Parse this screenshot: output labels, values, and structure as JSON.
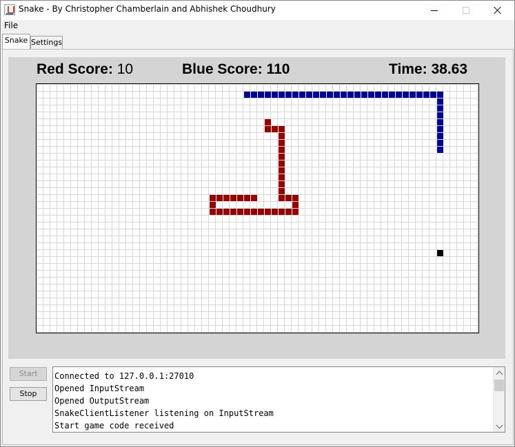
{
  "window": {
    "title": "Snake - By Christopher Chamberlain and Abhishek Choudhury",
    "icon": "java-cup-icon",
    "controls": [
      "minimize-icon",
      "maximize-icon",
      "close-icon"
    ]
  },
  "menubar": {
    "file_label": "File"
  },
  "tabs": [
    {
      "label": "Snake",
      "active": true
    },
    {
      "label": "Settings",
      "active": false
    }
  ],
  "hud": {
    "red_label": "Red Score:",
    "red_value": "10",
    "blue_label": "Blue Score:",
    "blue_value": "110",
    "time_label": "Time:",
    "time_value": "38.63"
  },
  "board": {
    "columns": 64,
    "rows": 36,
    "colors": {
      "red": "#990000",
      "blue": "#000099",
      "food": "#000000",
      "grid": "#d6d6d6"
    },
    "blue_snake": [
      [
        30,
        1
      ],
      [
        31,
        1
      ],
      [
        32,
        1
      ],
      [
        33,
        1
      ],
      [
        34,
        1
      ],
      [
        35,
        1
      ],
      [
        36,
        1
      ],
      [
        37,
        1
      ],
      [
        38,
        1
      ],
      [
        39,
        1
      ],
      [
        40,
        1
      ],
      [
        41,
        1
      ],
      [
        42,
        1
      ],
      [
        43,
        1
      ],
      [
        44,
        1
      ],
      [
        45,
        1
      ],
      [
        46,
        1
      ],
      [
        47,
        1
      ],
      [
        48,
        1
      ],
      [
        49,
        1
      ],
      [
        50,
        1
      ],
      [
        51,
        1
      ],
      [
        52,
        1
      ],
      [
        53,
        1
      ],
      [
        54,
        1
      ],
      [
        55,
        1
      ],
      [
        56,
        1
      ],
      [
        57,
        1
      ],
      [
        58,
        1
      ],
      [
        58,
        2
      ],
      [
        58,
        3
      ],
      [
        58,
        4
      ],
      [
        58,
        5
      ],
      [
        58,
        6
      ],
      [
        58,
        7
      ],
      [
        58,
        8
      ],
      [
        58,
        9
      ]
    ],
    "red_snake": [
      [
        33,
        5
      ],
      [
        33,
        6
      ],
      [
        34,
        6
      ],
      [
        35,
        6
      ],
      [
        35,
        7
      ],
      [
        35,
        8
      ],
      [
        35,
        9
      ],
      [
        35,
        10
      ],
      [
        35,
        11
      ],
      [
        35,
        12
      ],
      [
        35,
        13
      ],
      [
        35,
        14
      ],
      [
        35,
        15
      ],
      [
        35,
        16
      ],
      [
        36,
        16
      ],
      [
        37,
        16
      ],
      [
        37,
        17
      ],
      [
        37,
        18
      ],
      [
        36,
        18
      ],
      [
        35,
        18
      ],
      [
        34,
        18
      ],
      [
        33,
        18
      ],
      [
        32,
        18
      ],
      [
        31,
        18
      ],
      [
        30,
        18
      ],
      [
        29,
        18
      ],
      [
        28,
        18
      ],
      [
        27,
        18
      ],
      [
        26,
        18
      ],
      [
        25,
        18
      ],
      [
        25,
        17
      ],
      [
        25,
        16
      ],
      [
        26,
        16
      ],
      [
        27,
        16
      ],
      [
        28,
        16
      ],
      [
        29,
        16
      ],
      [
        30,
        16
      ],
      [
        31,
        16
      ]
    ],
    "food": [
      [
        58,
        24
      ]
    ]
  },
  "controls": {
    "start_label": "Start",
    "start_enabled": false,
    "stop_label": "Stop"
  },
  "log": {
    "lines": [
      "Connected to 127.0.0.1:27010",
      "Opened InputStream",
      "Opened OutputStream",
      "SnakeClientListener listening on InputStream",
      "Start game code received"
    ]
  }
}
